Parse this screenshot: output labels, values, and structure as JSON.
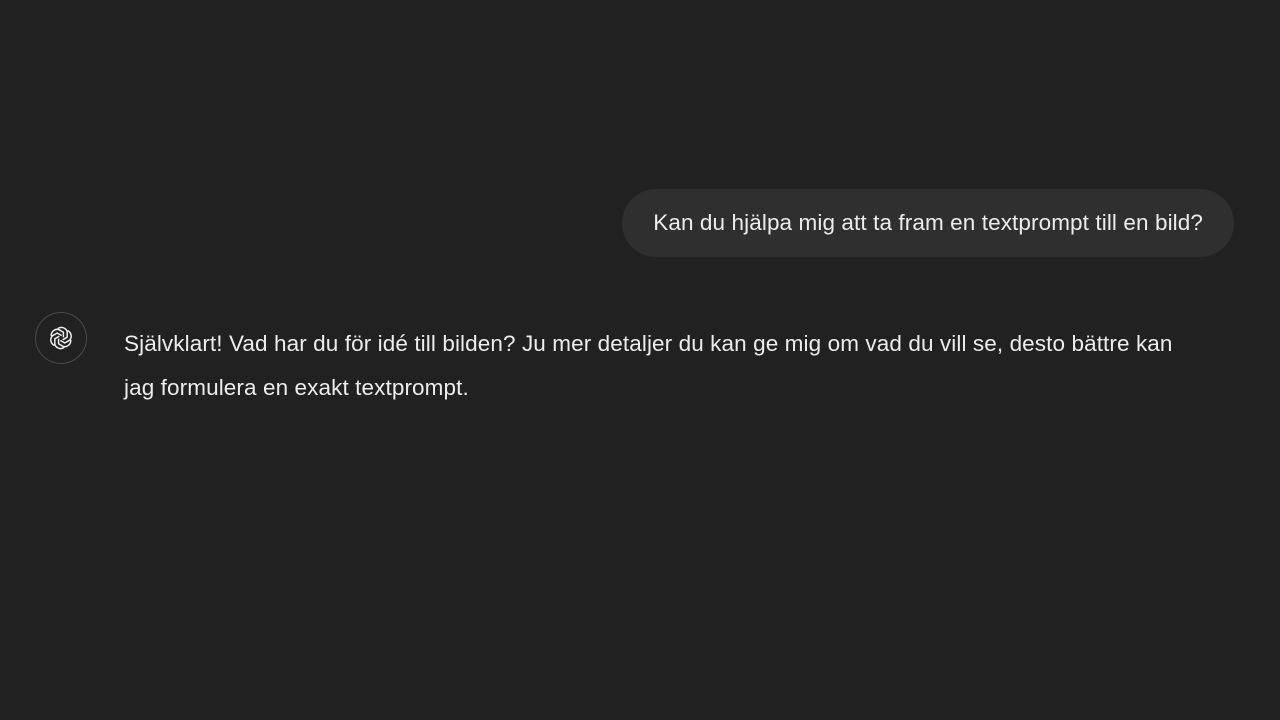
{
  "conversation": {
    "user_message": "Kan du hjälpa mig att ta fram en textprompt till en bild?",
    "assistant_message": "Självklart! Vad har du för idé till bilden? Ju mer detaljer du kan ge mig om vad du vill se, desto bättre kan jag formulera en exakt textprompt.",
    "assistant_avatar_icon": "openai-logo-icon"
  },
  "colors": {
    "background": "#212121",
    "user_bubble": "#2f2f2f",
    "text": "#ececec"
  }
}
